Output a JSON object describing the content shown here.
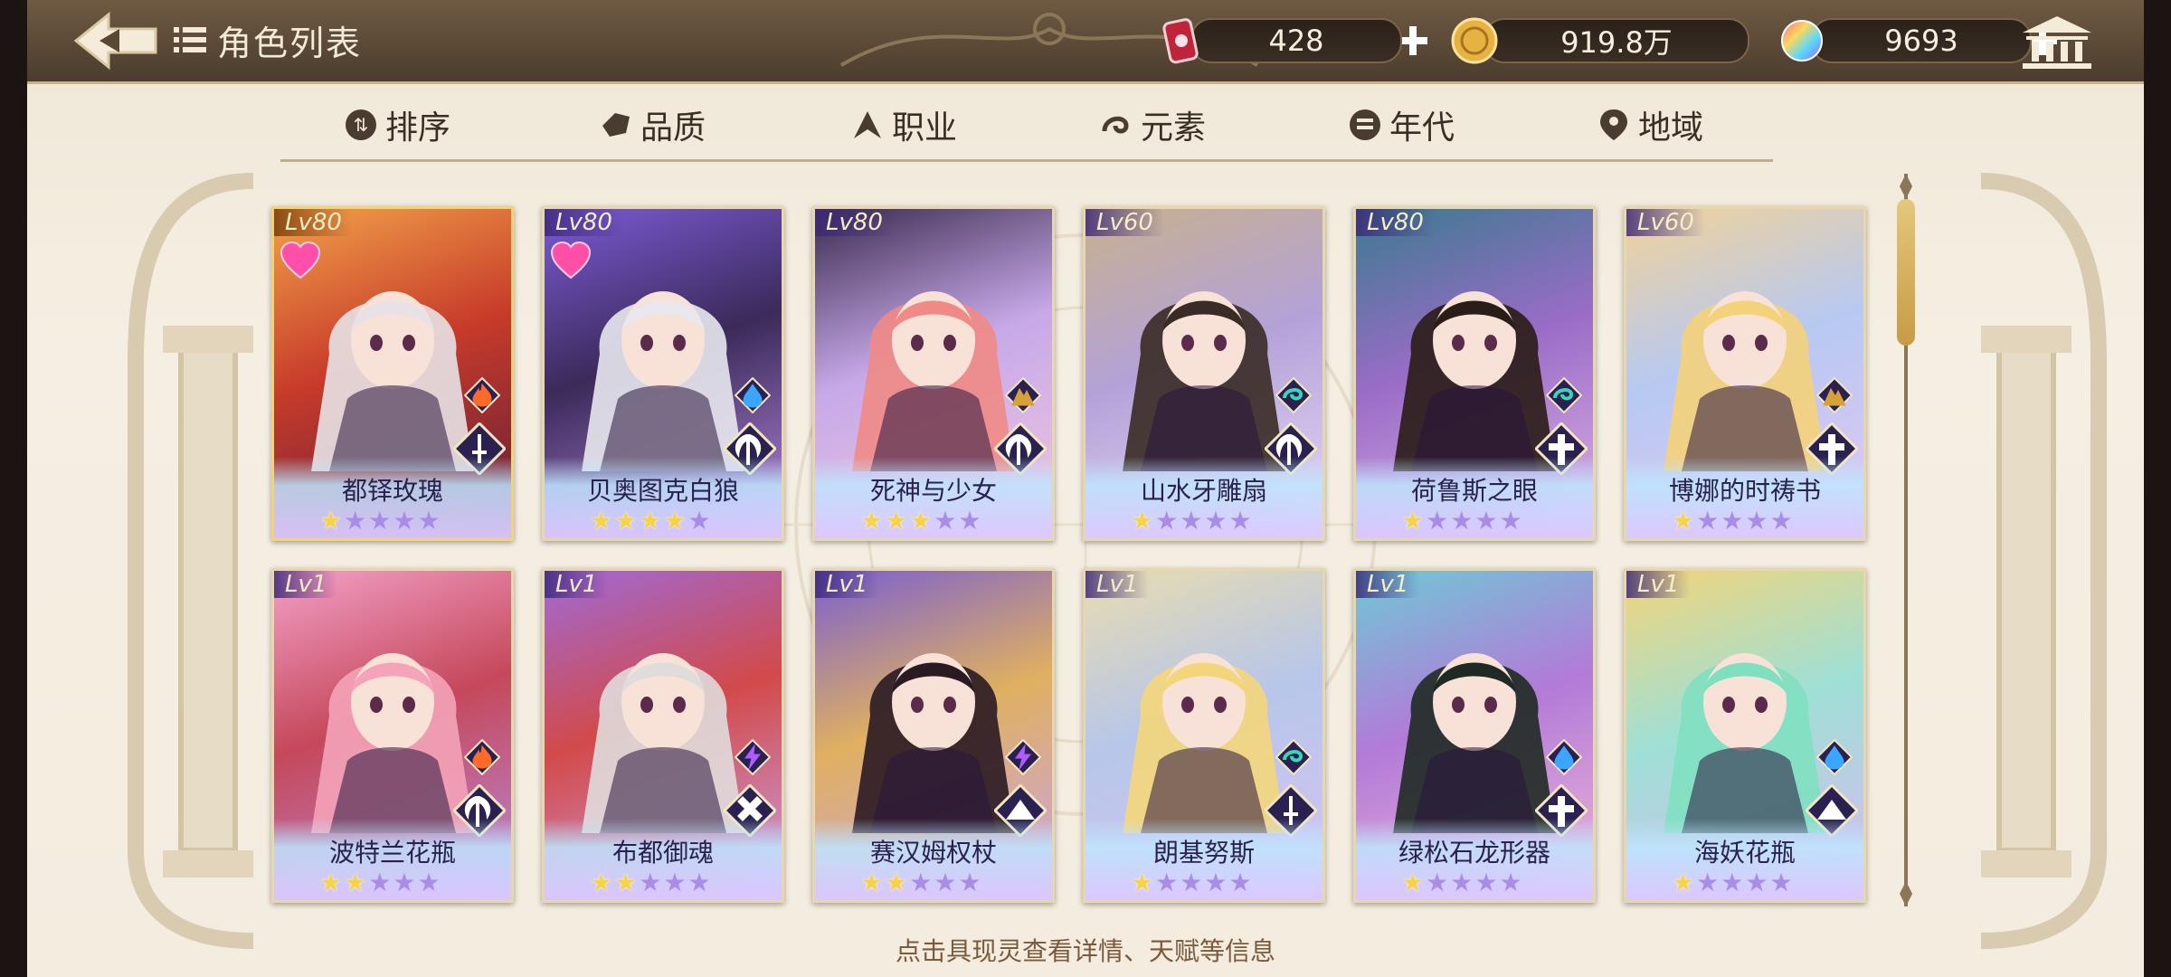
{
  "header": {
    "title": "角色列表",
    "resources": [
      {
        "icon": "energy-can-icon",
        "value": "428"
      },
      {
        "icon": "gold-coin-icon",
        "value": "919.8万"
      },
      {
        "icon": "rainbow-gem-icon",
        "value": "9693"
      }
    ]
  },
  "tabs": [
    {
      "label": "排序",
      "icon": "sort-icon"
    },
    {
      "label": "品质",
      "icon": "quality-icon"
    },
    {
      "label": "职业",
      "icon": "class-icon"
    },
    {
      "label": "元素",
      "icon": "element-icon"
    },
    {
      "label": "年代",
      "icon": "era-icon"
    },
    {
      "label": "地域",
      "icon": "location-icon"
    }
  ],
  "characters": [
    {
      "level": "Lv80",
      "name": "都铎玫瑰",
      "stars": 1,
      "favorite": true,
      "element": "fire",
      "class": "sword",
      "selected": true
    },
    {
      "level": "Lv80",
      "name": "贝奥图克白狼",
      "stars": 4,
      "favorite": true,
      "element": "water",
      "class": "scythe"
    },
    {
      "level": "Lv80",
      "name": "死神与少女",
      "stars": 3,
      "favorite": false,
      "element": "earth",
      "class": "scythe"
    },
    {
      "level": "Lv60",
      "name": "山水牙雕扇",
      "stars": 1,
      "favorite": false,
      "element": "wind",
      "class": "scythe"
    },
    {
      "level": "Lv80",
      "name": "荷鲁斯之眼",
      "stars": 1,
      "favorite": false,
      "element": "wind",
      "class": "cross"
    },
    {
      "level": "Lv60",
      "name": "博娜的时祷书",
      "stars": 1,
      "favorite": false,
      "element": "earth",
      "class": "cross"
    },
    {
      "level": "Lv1",
      "name": "波特兰花瓶",
      "stars": 2,
      "favorite": false,
      "element": "fire",
      "class": "scythe"
    },
    {
      "level": "Lv1",
      "name": "布都御魂",
      "stars": 2,
      "favorite": false,
      "element": "thunder",
      "class": "hammer"
    },
    {
      "level": "Lv1",
      "name": "赛汉姆权杖",
      "stars": 2,
      "favorite": false,
      "element": "thunder",
      "class": "book"
    },
    {
      "level": "Lv1",
      "name": "朗基努斯",
      "stars": 1,
      "favorite": false,
      "element": "wind",
      "class": "sword"
    },
    {
      "level": "Lv1",
      "name": "绿松石龙形器",
      "stars": 1,
      "favorite": false,
      "element": "water",
      "class": "cross"
    },
    {
      "level": "Lv1",
      "name": "海妖花瓶",
      "stars": 1,
      "favorite": false,
      "element": "water",
      "class": "book"
    }
  ],
  "footer": {
    "hint": "点击具现灵查看详情、天赋等信息"
  },
  "colors": {
    "accent": "#c89b44",
    "topbar": "#5a4836",
    "cardBorder": "#e8d7ad"
  }
}
